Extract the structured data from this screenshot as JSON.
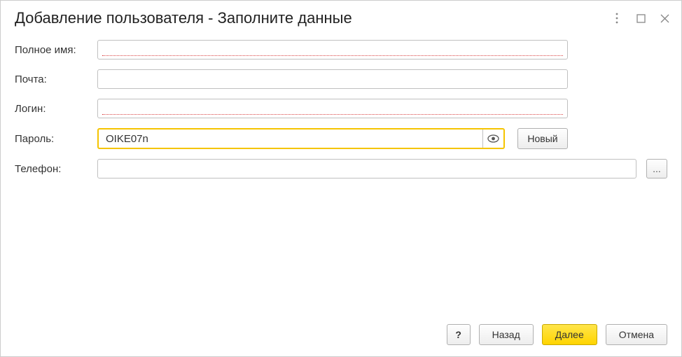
{
  "header": {
    "title": "Добавление пользователя - Заполните данные"
  },
  "fields": {
    "full_name": {
      "label": "Полное имя:",
      "value": ""
    },
    "email": {
      "label": "Почта:",
      "value": ""
    },
    "login": {
      "label": "Логин:",
      "value": ""
    },
    "password": {
      "label": "Пароль:",
      "value": "OIKE07n",
      "new_btn": "Новый"
    },
    "phone": {
      "label": "Телефон:",
      "value": "",
      "more": "..."
    }
  },
  "footer": {
    "help": "?",
    "back": "Назад",
    "next": "Далее",
    "cancel": "Отмена"
  }
}
